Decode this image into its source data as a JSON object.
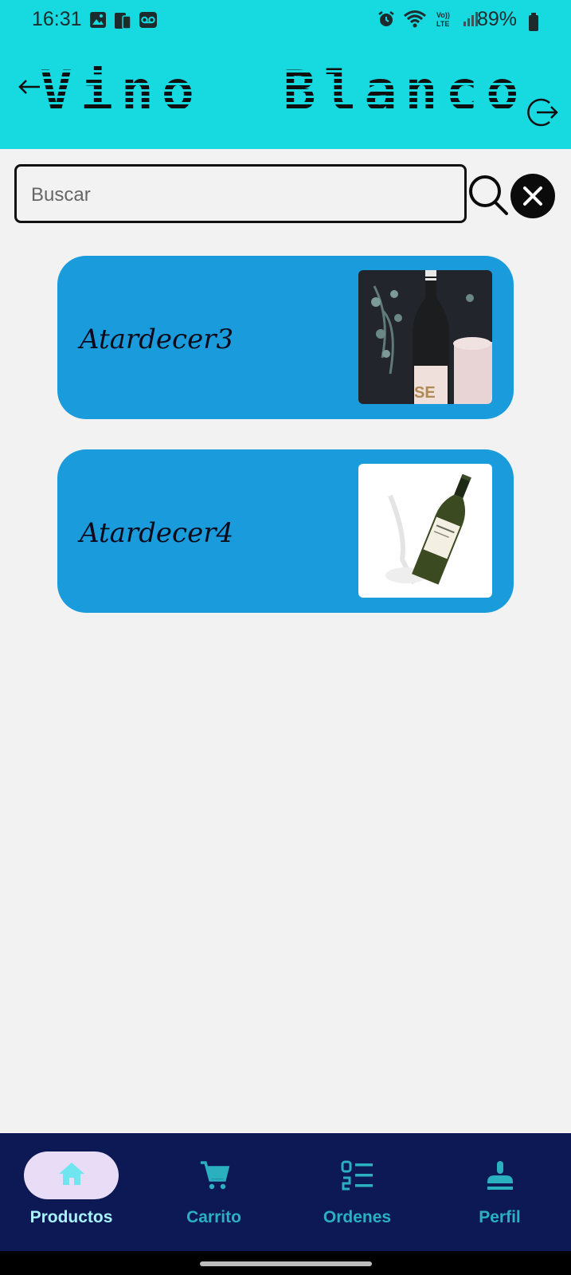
{
  "status_bar": {
    "time": "16:31",
    "battery": "89%"
  },
  "header": {
    "title": "Vino  Blanco"
  },
  "search": {
    "placeholder": "Buscar",
    "value": ""
  },
  "products": [
    {
      "name": "Atardecer3"
    },
    {
      "name": "Atardecer4"
    }
  ],
  "nav": {
    "items": [
      {
        "label": "Productos",
        "icon": "home-icon",
        "active": true
      },
      {
        "label": "Carrito",
        "icon": "cart-icon"
      },
      {
        "label": "Ordenes",
        "icon": "list-icon"
      },
      {
        "label": "Perfil",
        "icon": "profile-icon"
      }
    ]
  },
  "colors": {
    "header": "#17d9e0",
    "card": "#1a9cdc",
    "nav_bg": "#0c1955",
    "nav_active_pill": "#e8dcf6",
    "nav_label": "#2bb0c0"
  }
}
